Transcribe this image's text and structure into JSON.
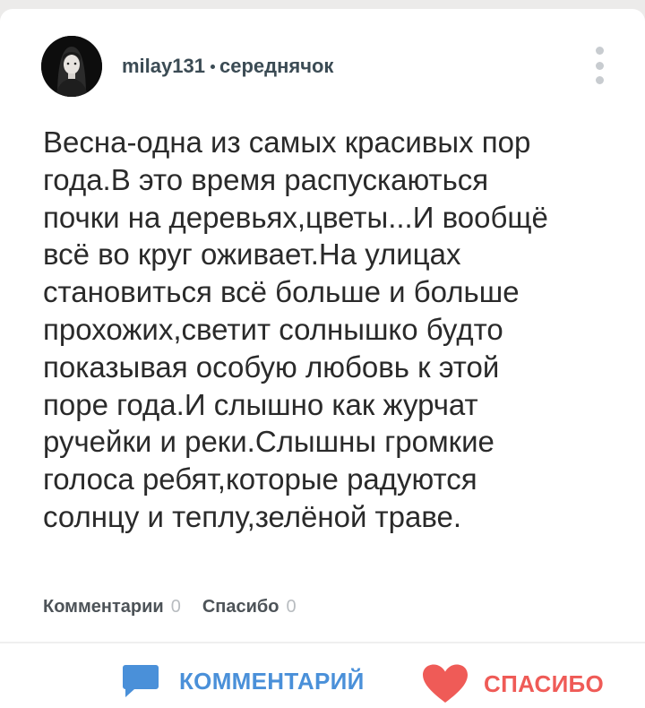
{
  "author": {
    "username": "milay131",
    "rank": "середнячок",
    "avatar_icon": "avatar-girl-dark"
  },
  "menu": {
    "icon": "more-vertical-icon"
  },
  "answer": {
    "lines": [
      "Весна-одна из самых красивых пор",
      "года.В это время распускаються",
      "почки на деревьях,цветы...И вообщё",
      "всё во круг оживает.На улицах",
      "становиться всё больше и больше",
      "прохожих,светит солнышко будто",
      "показывая особую любовь к этой",
      "поре года.И слышно как журчат",
      "ручейки и реки.Слышны громкие",
      "голоса ребят,которые радуются",
      "солнцу и теплу,зелёной траве."
    ]
  },
  "stats": {
    "comments_label": "Комментарии",
    "comments_count": "0",
    "thanks_label": "Спасибо",
    "thanks_count": "0"
  },
  "actions": {
    "comment_label": "КОММЕНТАРИЙ",
    "comment_icon": "speech-bubble-icon",
    "thanks_label": "СПАСИБО",
    "thanks_icon": "heart-icon"
  },
  "colors": {
    "accent_blue": "#4a90d9",
    "accent_red": "#ef5b57",
    "text_primary": "#2a2a2a",
    "text_secondary": "#3b4b54",
    "muted": "#b8bcc0",
    "card_background": "#ffffff",
    "page_background": "#ecebea"
  }
}
